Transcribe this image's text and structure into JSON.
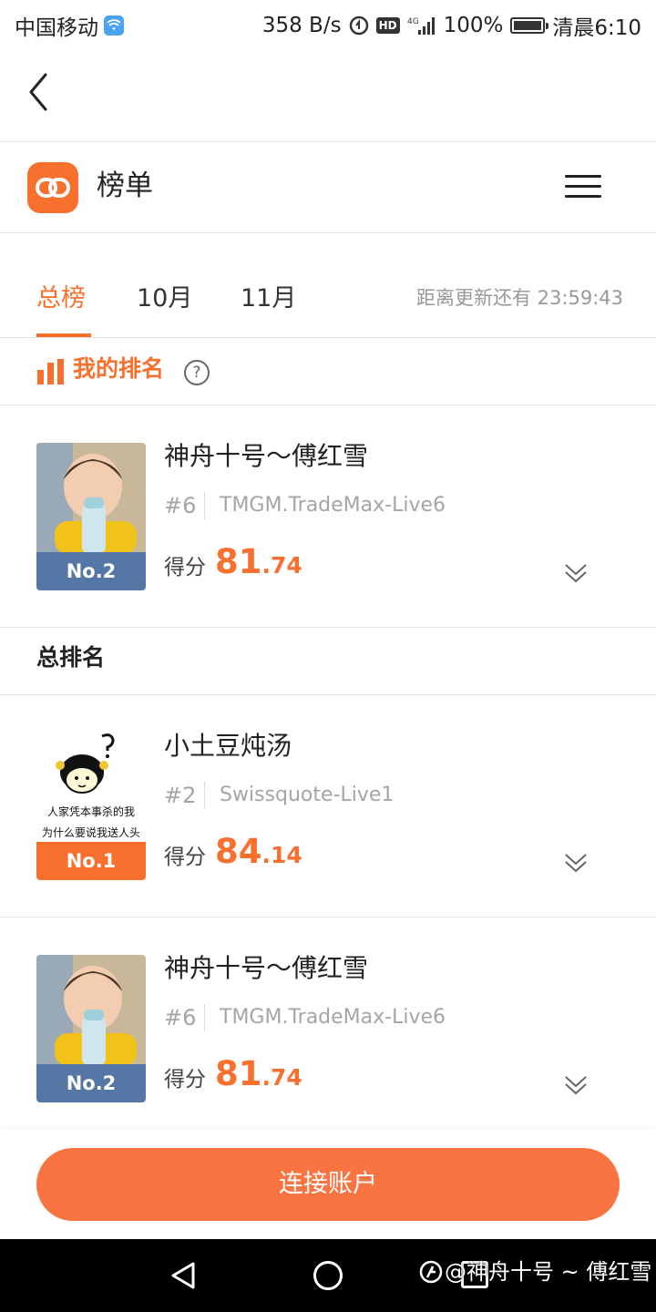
{
  "status_bar": {
    "carrier": "中国移动",
    "net_speed": "358 B/s",
    "battery_percent": "100%",
    "battery_level": 1.0,
    "time": "清晨6:10",
    "icons": [
      "wifi-icon",
      "data-saver-icon",
      "hd-icon",
      "signal-icon",
      "battery-icon"
    ],
    "hd_label": "HD"
  },
  "header": {
    "title": "榜单",
    "logo_icon": "link-logo-icon",
    "menu_icon": "hamburger-menu-icon"
  },
  "tabs": [
    {
      "label": "总榜",
      "active": true
    },
    {
      "label": "10月",
      "active": false
    },
    {
      "label": "11月",
      "active": false
    }
  ],
  "countdown": "距离更新还有 23:59:43",
  "my_rank": {
    "label": "我的排名",
    "help_symbol": "?",
    "card": {
      "name": "神舟十号～傅红雪",
      "position": "#6",
      "server": "TMGM.TradeMax-Live6",
      "rank_badge": "No.2",
      "score_label": "得分",
      "score_int": "81",
      "score_dec": ".74"
    }
  },
  "overall": {
    "title": "总排名",
    "entries": [
      {
        "name": "小土豆炖汤",
        "position": "#2",
        "server": "Swissquote-Live1",
        "rank_badge": "No.1",
        "score_label": "得分",
        "score_int": "84",
        "score_dec": ".14",
        "avatar_caption_1": "人家凭本事杀的我",
        "avatar_caption_2": "为什么要说我送人头"
      },
      {
        "name": "神舟十号～傅红雪",
        "position": "#6",
        "server": "TMGM.TradeMax-Live6",
        "rank_badge": "No.2",
        "score_label": "得分",
        "score_int": "81",
        "score_dec": ".74"
      }
    ]
  },
  "bottom": {
    "connect_label": "连接账户"
  },
  "watermark": "@神舟十号 ~ 傅红雪",
  "colors": {
    "accent": "#f7702d",
    "button": "#fa7442",
    "badge_blue": "#5577a6",
    "muted_text": "#a5a5a5"
  }
}
